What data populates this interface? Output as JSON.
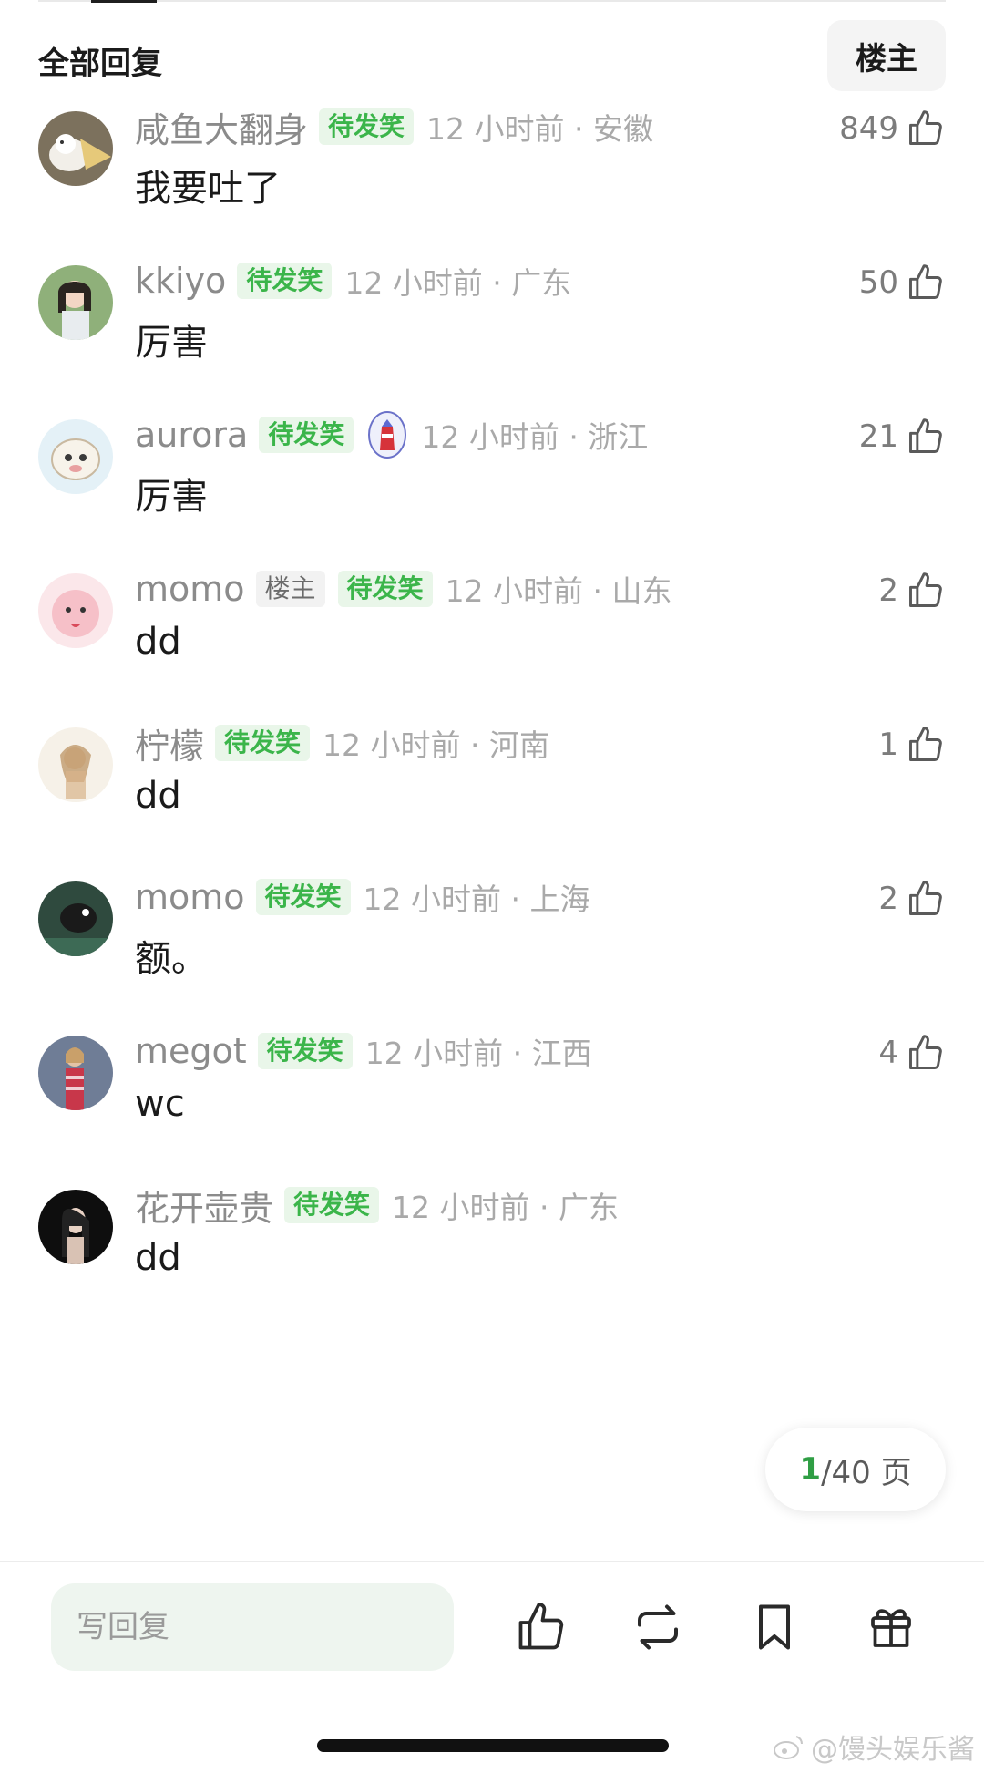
{
  "header": {
    "title": "全部回复",
    "op_filter_label": "楼主"
  },
  "comments": [
    {
      "username": "咸鱼大翻身",
      "tags": [
        "待发笑"
      ],
      "time": "12 小时前 · 安徽",
      "likes": "849",
      "content": "我要吐了"
    },
    {
      "username": "kkiyo",
      "tags": [
        "待发笑"
      ],
      "time": "12 小时前 · 广东",
      "likes": "50",
      "content": "厉害"
    },
    {
      "username": "aurora",
      "tags": [
        "待发笑"
      ],
      "badge": "lighthouse-badge-icon",
      "time": "12 小时前 · 浙江",
      "likes": "21",
      "content": "厉害"
    },
    {
      "username": "momo",
      "op_tag": "楼主",
      "tags": [
        "待发笑"
      ],
      "time": "12 小时前 · 山东",
      "likes": "2",
      "content": "dd"
    },
    {
      "username": "柠檬",
      "tags": [
        "待发笑"
      ],
      "time": "12 小时前 · 河南",
      "likes": "1",
      "content": "dd"
    },
    {
      "username": "momo",
      "tags": [
        "待发笑"
      ],
      "time": "12 小时前 · 上海",
      "likes": "2",
      "content": "额。"
    },
    {
      "username": "megot",
      "tags": [
        "待发笑"
      ],
      "time": "12 小时前 · 江西",
      "likes": "4",
      "content": "wc"
    },
    {
      "username": "花开壶贵",
      "tags": [
        "待发笑"
      ],
      "time": "12 小时前 · 广东",
      "likes": "",
      "content": "dd"
    }
  ],
  "pagination": {
    "current": "1",
    "total_suffix": "/40 页"
  },
  "bottom_bar": {
    "reply_placeholder": "写回复",
    "actions": [
      "thumbs-up-icon",
      "repost-icon",
      "bookmark-icon",
      "gift-icon"
    ]
  },
  "watermark": "@馒头娱乐酱",
  "colors": {
    "accent_green": "#3bb54a",
    "tag_bg": "#e9f6e9",
    "meta_gray": "#a9a9a9"
  }
}
